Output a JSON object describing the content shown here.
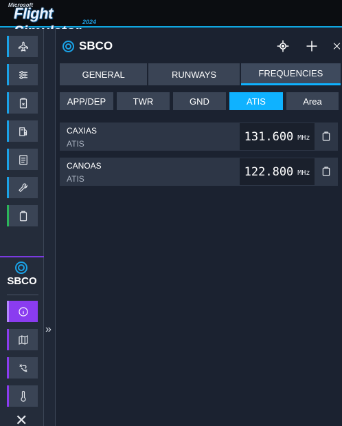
{
  "app": {
    "logo_brand": "Microsoft",
    "logo_title": "Flight Simulator",
    "logo_year": "2024"
  },
  "sidebar": {
    "items": [
      {
        "icon": "airplane-icon"
      },
      {
        "icon": "sliders-icon"
      },
      {
        "icon": "checklist-icon"
      },
      {
        "icon": "fuel-icon"
      },
      {
        "icon": "notes-icon"
      },
      {
        "icon": "wrench-icon"
      },
      {
        "icon": "clipboard-icon"
      }
    ],
    "airport_code": "SBCO",
    "airport_items": [
      {
        "icon": "info-icon"
      },
      {
        "icon": "map-icon"
      },
      {
        "icon": "route-icon"
      },
      {
        "icon": "thermometer-icon"
      }
    ],
    "close_label": "✕",
    "collapse_label": "»"
  },
  "panel": {
    "title": "SBCO",
    "tabs": [
      {
        "label": "GENERAL"
      },
      {
        "label": "RUNWAYS"
      },
      {
        "label": "FREQUENCIES",
        "active": true
      }
    ],
    "subtabs": [
      {
        "label": "APP/DEP"
      },
      {
        "label": "TWR"
      },
      {
        "label": "GND"
      },
      {
        "label": "ATIS",
        "active": true
      },
      {
        "label": "Area"
      }
    ],
    "frequencies": [
      {
        "name": "CAXIAS",
        "type": "ATIS",
        "value": "131.600",
        "unit": "MHz"
      },
      {
        "name": "CANOAS",
        "type": "ATIS",
        "value": "122.800",
        "unit": "MHz"
      }
    ]
  },
  "colors": {
    "accent_blue": "#0fb2ff",
    "accent_purple": "#8a3cf0",
    "accent_green": "#2bb55a"
  }
}
